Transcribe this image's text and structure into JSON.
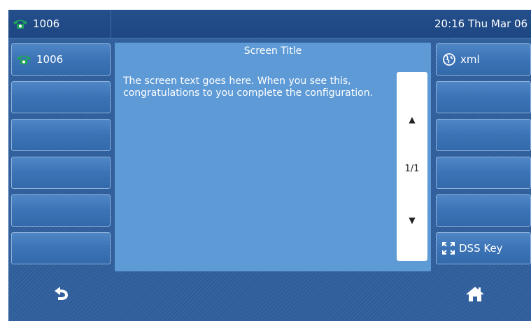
{
  "status_bar": {
    "account": "1006",
    "datetime": "20:16 Thu Mar 06"
  },
  "line_keys_left": [
    {
      "label": "1006",
      "icon": "phone-icon"
    },
    {
      "label": ""
    },
    {
      "label": ""
    },
    {
      "label": ""
    },
    {
      "label": ""
    },
    {
      "label": ""
    }
  ],
  "line_keys_right": [
    {
      "label": "xml",
      "icon": "globe-icon"
    },
    {
      "label": ""
    },
    {
      "label": ""
    },
    {
      "label": ""
    },
    {
      "label": ""
    },
    {
      "label": "DSS Key",
      "icon": "expand-icon"
    }
  ],
  "message": {
    "title": "Screen Title",
    "text": "The screen text goes here. When you see this, congratulations to you complete the configuration.",
    "page_indicator": "1/1"
  },
  "softkeys": {
    "back_icon": "back-icon",
    "home_icon": "home-icon"
  },
  "colors": {
    "background": "#2f5f9e",
    "panel": "#5d9ad6",
    "phone_icon": "#1fa35a"
  }
}
